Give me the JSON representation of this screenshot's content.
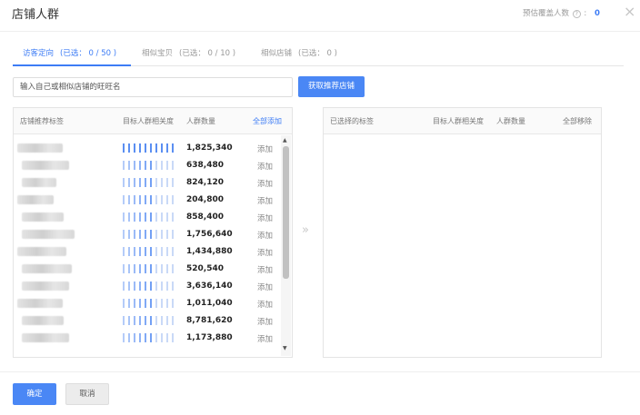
{
  "dialog": {
    "title": "店铺人群",
    "coverage_label": "预估覆盖人数",
    "coverage_help_icon": "?",
    "coverage_value": "0",
    "close_icon": "×"
  },
  "tabs": [
    {
      "label": "访客定向",
      "count": "(已选： 0 / 50 )",
      "active": true
    },
    {
      "label": "相似宝贝",
      "count": "(已选： 0 / 10 )",
      "active": false
    },
    {
      "label": "相似店铺",
      "count": "(已选： 0 )",
      "active": false
    }
  ],
  "search": {
    "placeholder": "输入自己或相似店铺的旺旺名",
    "button_label": "获取推荐店铺"
  },
  "left_panel": {
    "col_tag": "店铺推荐标签",
    "col_relevance": "目标人群相关度",
    "col_count": "人群数量",
    "col_add_all": "全部添加",
    "add_label": "添加",
    "rows": [
      {
        "count": "1,825,340",
        "relevance": 10
      },
      {
        "count": "638,480",
        "relevance": 6
      },
      {
        "count": "824,120",
        "relevance": 6
      },
      {
        "count": "204,800",
        "relevance": 6
      },
      {
        "count": "858,400",
        "relevance": 6
      },
      {
        "count": "1,756,640",
        "relevance": 6
      },
      {
        "count": "1,434,880",
        "relevance": 6
      },
      {
        "count": "520,540",
        "relevance": 6
      },
      {
        "count": "3,636,140",
        "relevance": 6
      },
      {
        "count": "1,011,040",
        "relevance": 6
      },
      {
        "count": "8,781,620",
        "relevance": 6
      },
      {
        "count": "1,173,880",
        "relevance": 6
      }
    ]
  },
  "right_panel": {
    "col_selected": "已选择的标签",
    "col_relevance": "目标人群相关度",
    "col_count": "人群数量",
    "col_remove_all": "全部移除"
  },
  "transfer_icon": "»",
  "footer": {
    "confirm_label": "确定",
    "cancel_label": "取消"
  },
  "colors": {
    "accent": "#3d7cf5",
    "bar_filled": "#5b8ff2",
    "bar_empty": "#c9d9f7"
  }
}
